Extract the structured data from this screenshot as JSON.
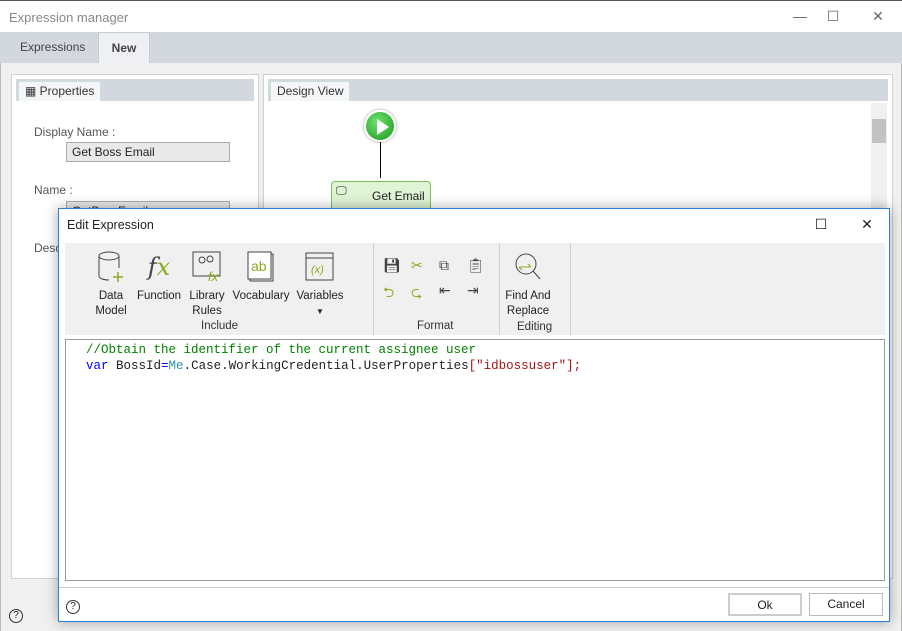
{
  "window": {
    "title": "Expression manager",
    "minimize": "—",
    "maximize": "☐",
    "close": "✕"
  },
  "tabs": [
    {
      "label": "Expressions"
    },
    {
      "label": "New"
    }
  ],
  "properties": {
    "tab": "Properties",
    "display_name_label": "Display Name :",
    "display_name_value": "Get Boss Email",
    "name_label": "Name :",
    "name_value": "GetBossEmail",
    "description_label": "Desc"
  },
  "design": {
    "tab": "Design View",
    "task_label": "Get Email"
  },
  "dialog": {
    "title": "Edit Expression",
    "maximize": "☐",
    "close": "✕",
    "ribbon": {
      "include": {
        "label": "Include",
        "buttons": [
          "Data\nModel",
          "Function",
          "Library\nRules",
          "Vocabulary",
          "Variables"
        ]
      },
      "format": {
        "label": "Format"
      },
      "editing": {
        "label": "Editing",
        "find_replace": "Find And\nReplace"
      }
    },
    "code": {
      "comment": "//Obtain the identifier of the current assignee user",
      "kw": "var",
      "ident": " BossId",
      "eq": "=",
      "me": "Me",
      "rest": ".Case.WorkingCredential.UserProperties",
      "lb": "[",
      "str": "\"idbossuser\"",
      "rb": "];"
    },
    "ok": "Ok",
    "cancel": "Cancel",
    "help": "?"
  },
  "footer": {
    "help": "?"
  },
  "colors": {
    "accent": "#2b7fd6",
    "comment": "#008000",
    "keyword": "#0000ff",
    "string": "#a31515",
    "me": "#2b91af"
  }
}
